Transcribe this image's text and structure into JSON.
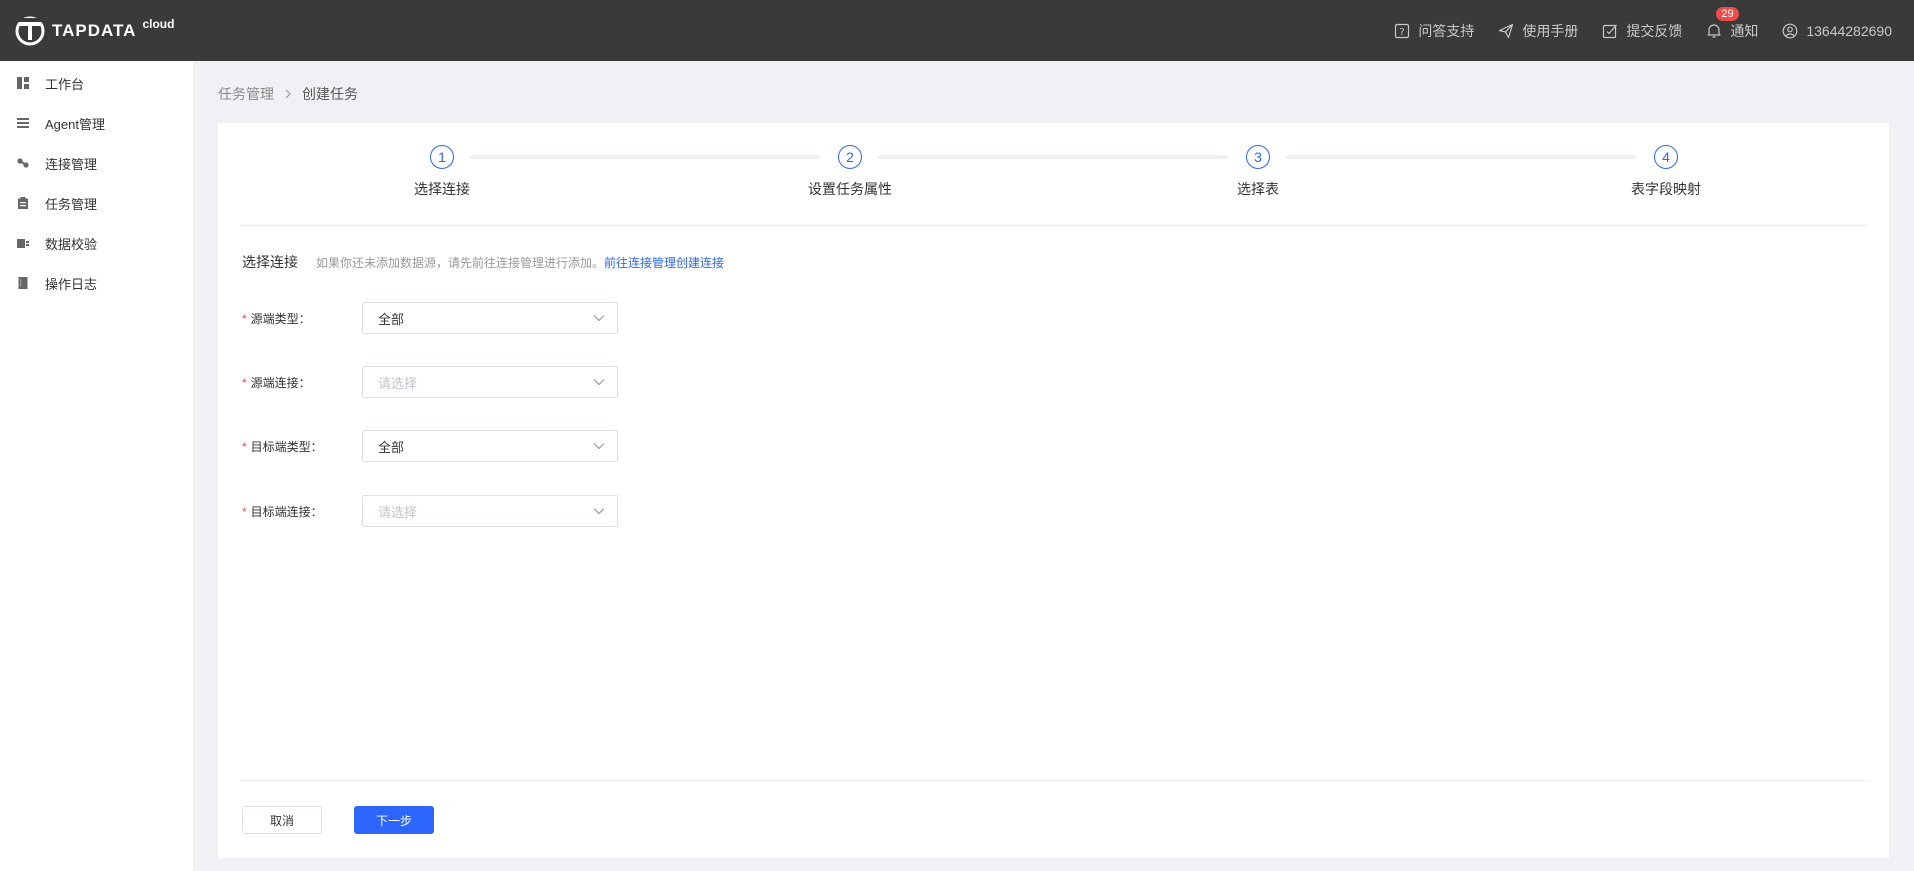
{
  "topbar": {
    "brand": "TAPDATA",
    "brand_suffix": "cloud",
    "items": [
      {
        "icon": "question-icon",
        "label": "问答支持"
      },
      {
        "icon": "paper-plane-icon",
        "label": "使用手册"
      },
      {
        "icon": "feedback-icon",
        "label": "提交反馈"
      },
      {
        "icon": "bell-icon",
        "label": "通知",
        "badge": "29"
      },
      {
        "icon": "user-icon",
        "label": "13644282690"
      }
    ]
  },
  "sidebar": {
    "items": [
      {
        "icon": "dashboard-icon",
        "label": "工作台"
      },
      {
        "icon": "list-icon",
        "label": "Agent管理"
      },
      {
        "icon": "link-icon",
        "label": "连接管理"
      },
      {
        "icon": "clipboard-icon",
        "label": "任务管理"
      },
      {
        "icon": "check-icon",
        "label": "数据校验"
      },
      {
        "icon": "document-icon",
        "label": "操作日志"
      }
    ]
  },
  "breadcrumb": {
    "parent": "任务管理",
    "current": "创建任务"
  },
  "steps": [
    {
      "number": "1",
      "label": "选择连接"
    },
    {
      "number": "2",
      "label": "设置任务属性"
    },
    {
      "number": "3",
      "label": "选择表"
    },
    {
      "number": "4",
      "label": "表字段映射"
    }
  ],
  "section": {
    "title": "选择连接",
    "tip": "如果你还未添加数据源，请先前往连接管理进行添加。",
    "link": "前往连接管理创建连接"
  },
  "form": {
    "required_mark": "*",
    "fields": [
      {
        "label": "源端类型：",
        "value": "全部",
        "placeholder": false
      },
      {
        "label": "源端连接：",
        "value": "请选择",
        "placeholder": true
      },
      {
        "label": "目标端类型：",
        "value": "全部",
        "placeholder": false
      },
      {
        "label": "目标端连接：",
        "value": "请选择",
        "placeholder": true
      }
    ]
  },
  "actions": {
    "cancel": "取消",
    "next": "下一步"
  },
  "colors": {
    "topbar_bg": "#3a3a3a",
    "primary": "#2c65ff",
    "badge": "#f04c4c",
    "page_bg": "#eff1f4"
  }
}
